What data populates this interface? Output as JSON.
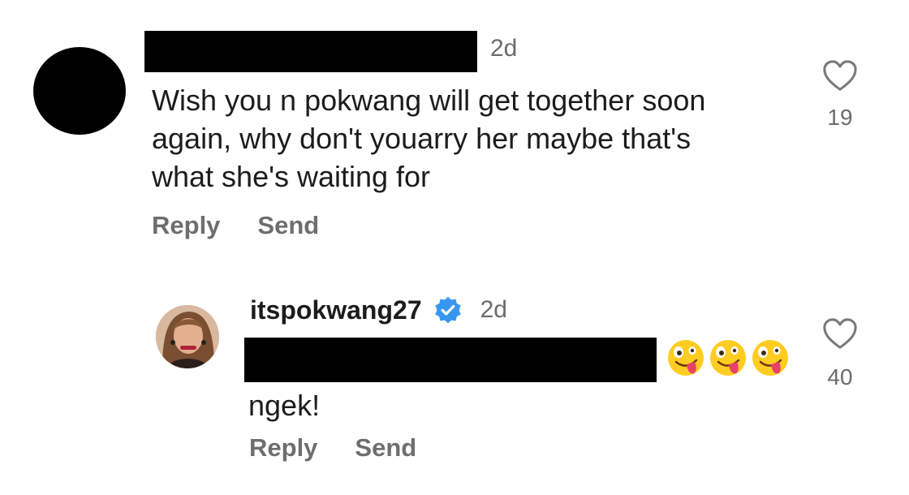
{
  "comments": [
    {
      "time": "2d",
      "lines": [
        "Wish you n pokwang will get together soon",
        "again, why don't youarry her maybe that's",
        "what she's waiting for"
      ],
      "reply_label": "Reply",
      "send_label": "Send",
      "likes": "19"
    },
    {
      "username": "itspokwang27",
      "verified": true,
      "time": "2d",
      "emojis": [
        "zany-face-emoji",
        "zany-face-emoji",
        "zany-face-emoji"
      ],
      "text": "ngek!",
      "reply_label": "Reply",
      "send_label": "Send",
      "likes": "40"
    }
  ],
  "colors": {
    "text": "#1c1c1c",
    "muted": "#6b6b6b",
    "verified_blue": "#3797f0",
    "redaction": "#000000"
  }
}
